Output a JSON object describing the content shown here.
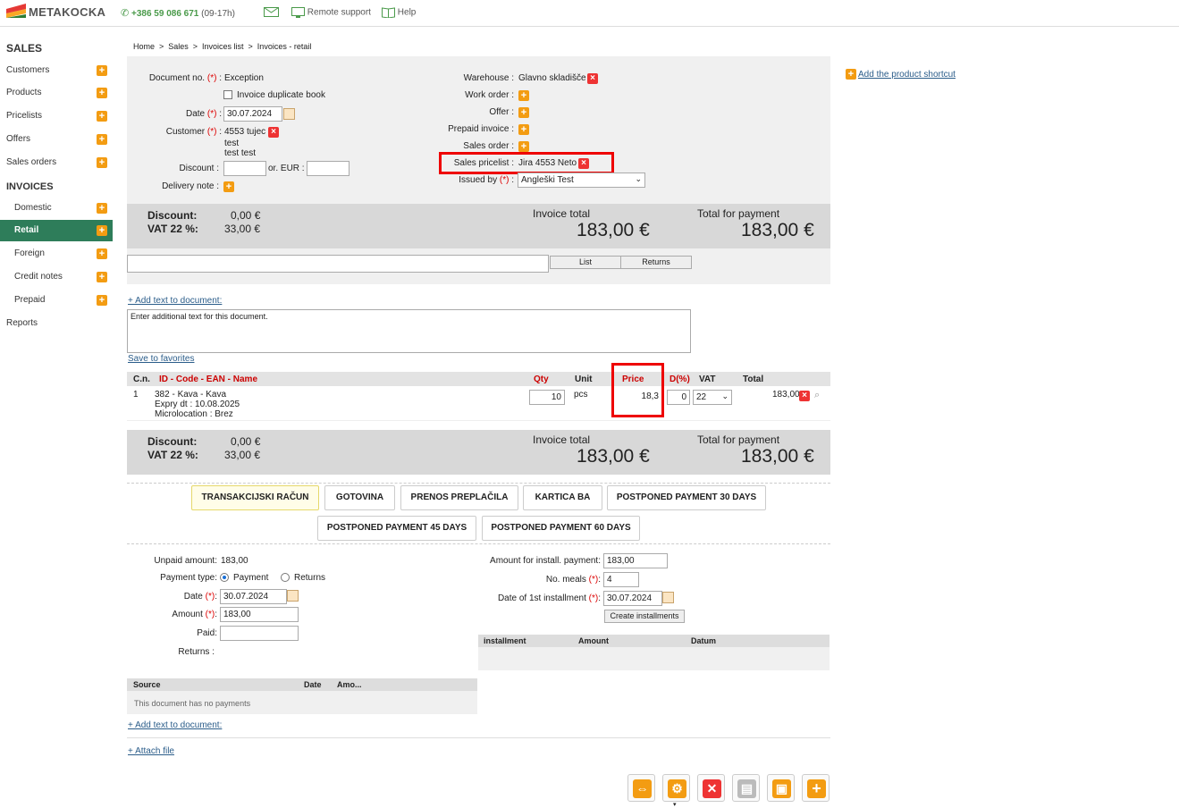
{
  "topbar": {
    "logo": "METAKOCKA",
    "phone": "+386 59 086 671",
    "hours": "(09-17h)",
    "remote_support": "Remote support",
    "help": "Help"
  },
  "sidebar": {
    "sales_head": "SALES",
    "sales_items": [
      "Customers",
      "Products",
      "Pricelists",
      "Offers",
      "Sales orders"
    ],
    "invoices_head": "INVOICES",
    "invoice_items": [
      "Domestic",
      "Retail",
      "Foreign",
      "Credit notes",
      "Prepaid"
    ],
    "reports": "Reports"
  },
  "breadcrumb": "Home  >  Sales  >  Invoices list  >  Invoices - retail",
  "form": {
    "doc_no_label": "Document no.",
    "doc_no_value": "Exception",
    "duplicate_book": "Invoice duplicate book",
    "date_label": "Date",
    "date_value": "30.07.2024",
    "customer_label": "Customer",
    "customer_value": "4553 tujec",
    "customer_line2": "test",
    "customer_line3": "test test",
    "discount_label": "Discount :",
    "or_eur": "or. EUR :",
    "delivery_note": "Delivery note :",
    "warehouse_label": "Warehouse :",
    "warehouse_value": "Glavno skladišče",
    "work_order": "Work order :",
    "offer": "Offer :",
    "prepaid_invoice": "Prepaid invoice :",
    "sales_order": "Sales order :",
    "sales_pricelist_label": "Sales pricelist :",
    "sales_pricelist_value": "Jira 4553 Neto",
    "issued_by_label": "Issued by",
    "issued_by_value": "Angleški Test",
    "req_mark": "(*)",
    "colon": ":"
  },
  "product_shortcut": "Add the product shortcut",
  "totals": {
    "discount_label": "Discount:",
    "discount_value": "0,00 €",
    "vat_label": "VAT 22 %:",
    "vat_value": "33,00 €",
    "invoice_total_label": "Invoice total",
    "invoice_total_value": "183,00 €",
    "payment_total_label": "Total for payment",
    "payment_total_value": "183,00 €"
  },
  "search": {
    "list_btn": "List",
    "returns_btn": "Returns"
  },
  "add_text": "+ Add text to document:",
  "additional_text": "Enter additional text for this document.",
  "save_favorites": "Save to favorites",
  "items_table": {
    "headers": [
      "C.n.",
      "ID - Code - EAN - Name",
      "Qty",
      "Unit",
      "Price",
      "D(%)",
      "VAT",
      "Total"
    ],
    "rows": [
      {
        "cn": "1",
        "name": "382 - Kava - Kava",
        "expiry": "Expry dt : 10.08.2025",
        "location": "Microlocation : Brez",
        "qty": "10",
        "unit": "pcs",
        "price": "18,3",
        "discount": "0",
        "vat": "22",
        "total": "183,00"
      }
    ]
  },
  "payment_buttons": [
    "TRANSAKCIJSKI RAČUN",
    "GOTOVINA",
    "PRENOS PREPLAČILA",
    "KARTICA BA",
    "POSTPONED PAYMENT 30 DAYS",
    "POSTPONED PAYMENT 45 DAYS",
    "POSTPONED PAYMENT 60 DAYS"
  ],
  "payment": {
    "unpaid_label": "Unpaid amount:",
    "unpaid_value": "183,00",
    "type_label": "Payment type:",
    "type_payment": "Payment",
    "type_returns": "Returns",
    "date_label": "Date",
    "date_value": "30.07.2024",
    "amount_label": "Amount",
    "amount_value": "183,00",
    "paid_label": "Paid:",
    "returns_label": "Returns :",
    "install_amount_label": "Amount for install. payment:",
    "install_amount_value": "183,00",
    "no_meals_label": "No. meals",
    "no_meals_value": "4",
    "first_install_label": "Date of 1st installment",
    "first_install_value": "30.07.2024",
    "create_installments": "Create installments"
  },
  "install_table": {
    "headers": [
      "installment",
      "Amount",
      "Datum"
    ]
  },
  "payments_table": {
    "headers": [
      "Source",
      "Date",
      "Amo..."
    ],
    "empty": "This document has no payments"
  },
  "add_text2": "+ Add text to document:",
  "attach_file": "+ Attach file"
}
